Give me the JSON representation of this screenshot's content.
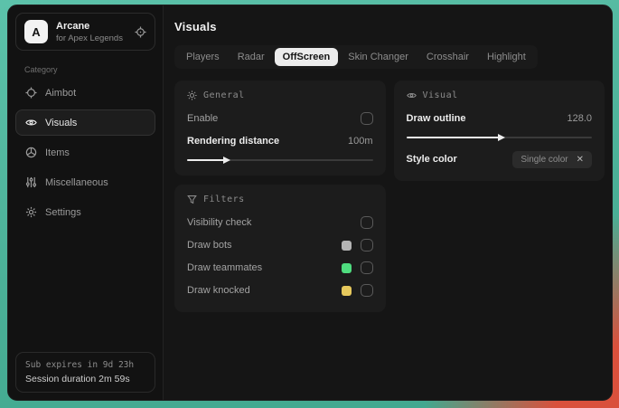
{
  "app": {
    "logo_letter": "A",
    "name": "Arcane",
    "subtitle": "for Apex Legends"
  },
  "sidebar": {
    "category_label": "Category",
    "items": [
      {
        "label": "Aimbot",
        "icon": "crosshair-icon",
        "selected": false
      },
      {
        "label": "Visuals",
        "icon": "eye-icon",
        "selected": true
      },
      {
        "label": "Items",
        "icon": "package-icon",
        "selected": false
      },
      {
        "label": "Miscellaneous",
        "icon": "sliders-icon",
        "selected": false
      },
      {
        "label": "Settings",
        "icon": "gear-icon",
        "selected": false
      }
    ],
    "status": {
      "line1": "Sub expires in 9d 23h",
      "line2": "Session duration 2m 59s"
    }
  },
  "main": {
    "title": "Visuals",
    "tabs": [
      {
        "label": "Players",
        "selected": false
      },
      {
        "label": "Radar",
        "selected": false
      },
      {
        "label": "OffScreen",
        "selected": true
      },
      {
        "label": "Skin Changer",
        "selected": false
      },
      {
        "label": "Crosshair",
        "selected": false
      },
      {
        "label": "Highlight",
        "selected": false
      }
    ],
    "general": {
      "title": "General",
      "enable_label": "Enable",
      "enable_checked": false,
      "distance_label": "Rendering distance",
      "distance_value": "100m",
      "distance_percent": "20%"
    },
    "visual": {
      "title": "Visual",
      "outline_label": "Draw outline",
      "outline_value": "128.0",
      "outline_percent": "50%",
      "style_label": "Style color",
      "style_value": "Single color",
      "style_clear": "✕"
    },
    "filters": {
      "title": "Filters",
      "rows": [
        {
          "label": "Visibility check",
          "swatch": null,
          "checked": false
        },
        {
          "label": "Draw bots",
          "swatch": "#b4b4b4",
          "checked": false
        },
        {
          "label": "Draw teammates",
          "swatch": "#4fdc7f",
          "checked": false
        },
        {
          "label": "Draw knocked",
          "swatch": "#e6c85c",
          "checked": false
        }
      ]
    }
  },
  "colors": {
    "desktop_teal": "#4bb097",
    "desktop_red": "#d9503c",
    "selected_tab_bg": "#ececec",
    "selected_tab_text": "#141414"
  }
}
